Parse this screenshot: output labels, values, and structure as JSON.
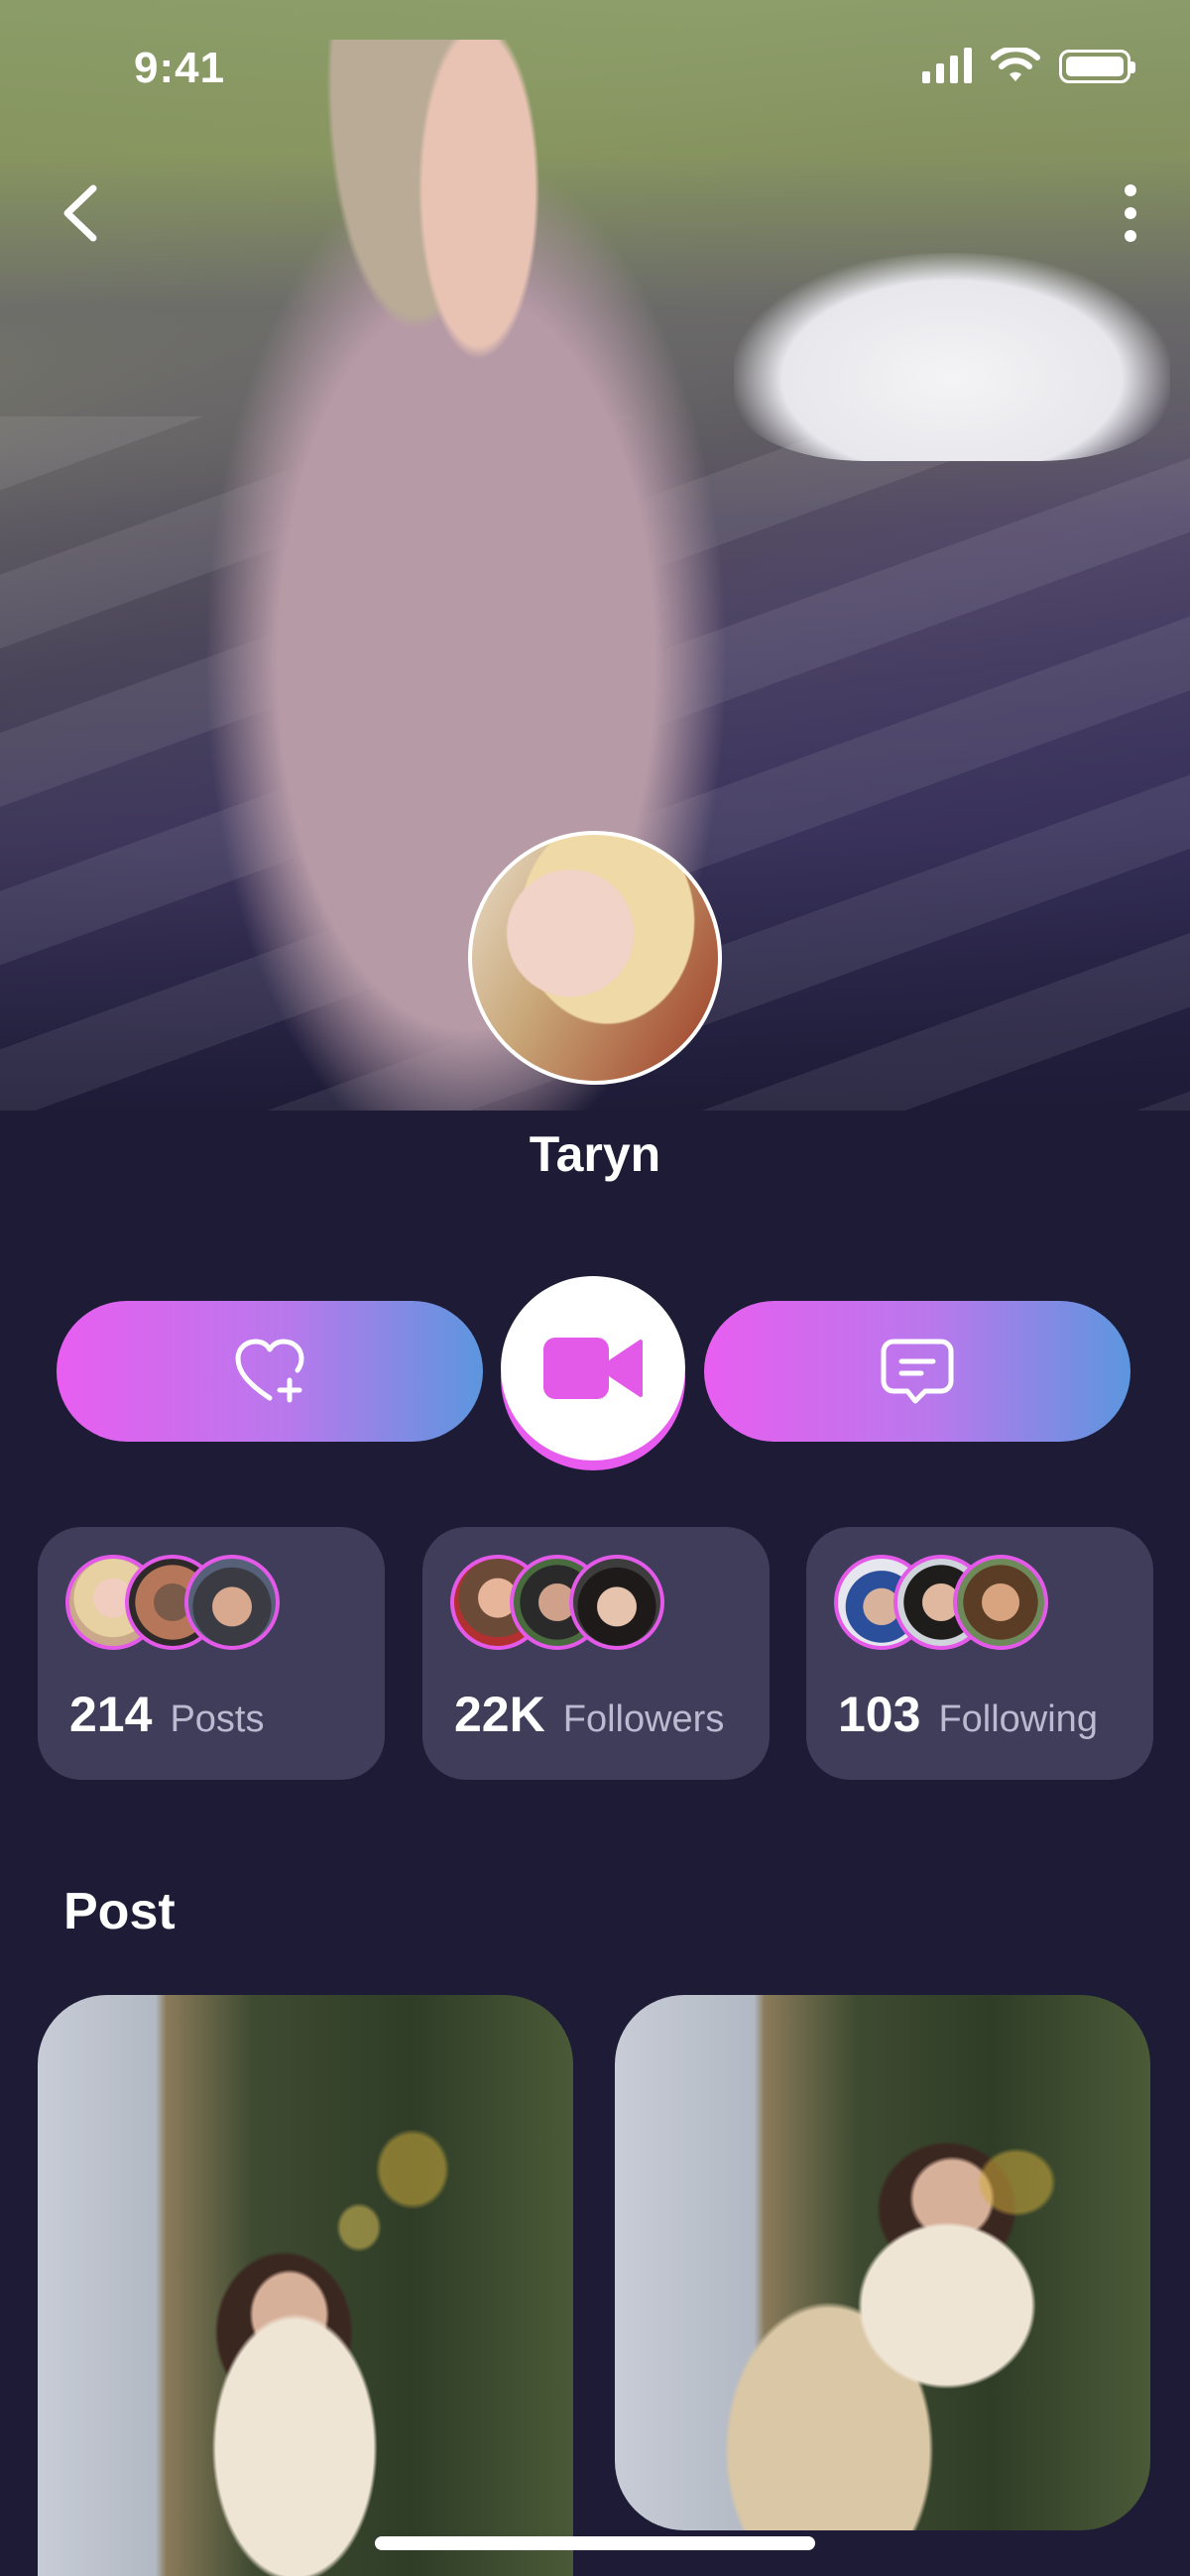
{
  "status_bar": {
    "time": "9:41"
  },
  "profile": {
    "name": "Taryn"
  },
  "stats": [
    {
      "value": "214",
      "label": "Posts"
    },
    {
      "value": "22K",
      "label": "Followers"
    },
    {
      "value": "103",
      "label": "Following"
    }
  ],
  "posts_section": {
    "title": "Post"
  },
  "icons": {
    "back": "chevron-left-icon",
    "more": "more-vertical-icon",
    "like": "heart-plus-icon",
    "video": "video-camera-icon",
    "message": "message-icon"
  },
  "colors": {
    "background": "#1d1b36",
    "card": "#403d5b",
    "accent_pink": "#e85ef0",
    "accent_blue": "#5c96de",
    "avatar_ring": "#e35ae9"
  }
}
